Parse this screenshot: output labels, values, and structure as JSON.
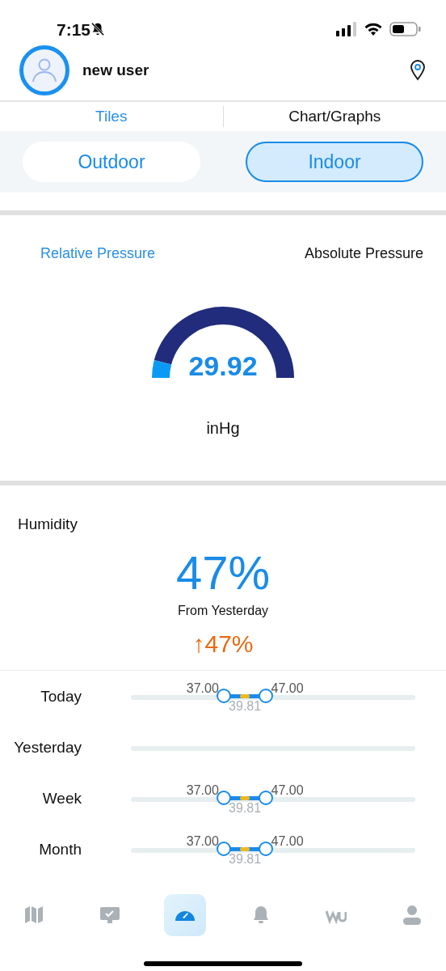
{
  "status_bar": {
    "time": "7:15",
    "silent": true
  },
  "header": {
    "user_name": "new user"
  },
  "view_tabs": [
    {
      "label": "Tiles",
      "selected": true
    },
    {
      "label": "Chart/Graphs",
      "selected": false
    }
  ],
  "location_tabs": [
    {
      "label": "Outdoor",
      "selected": false
    },
    {
      "label": "Indoor",
      "selected": true
    }
  ],
  "pressure": {
    "tabs": [
      {
        "label": "Relative Pressure",
        "selected": true
      },
      {
        "label": "Absolute Pressure",
        "selected": false
      }
    ],
    "gauge": {
      "value": "29.92"
    },
    "unit": "inHg"
  },
  "humidity": {
    "title": "Humidity",
    "value": "47%",
    "compare_label": "From Yesterday",
    "change": "↑47%"
  },
  "ranges": [
    {
      "label": "Today",
      "low": "37.00",
      "high": "47.00",
      "mean": "39.81",
      "low_pos": {
        "level": 0.327
      },
      "high_pos": {
        "level": 0.475
      }
    },
    {
      "label": "Yesterday"
    },
    {
      "label": "Week",
      "low": "37.00",
      "high": "47.00",
      "mean": "39.81",
      "low_pos": {
        "level": 0.327
      },
      "high_pos": {
        "level": 0.475
      }
    },
    {
      "label": "Month",
      "low": "37.00",
      "high": "47.00",
      "mean": "39.81",
      "low_pos": {
        "level": 0.327
      },
      "high_pos": {
        "level": 0.475
      }
    }
  ],
  "bottom_nav": [
    {
      "kind": "map",
      "selected": false
    },
    {
      "kind": "monitor",
      "selected": false
    },
    {
      "kind": "dashboard",
      "selected": true
    },
    {
      "kind": "alerts",
      "selected": false
    },
    {
      "kind": "logo",
      "selected": false
    },
    {
      "kind": "profile",
      "selected": false
    }
  ]
}
